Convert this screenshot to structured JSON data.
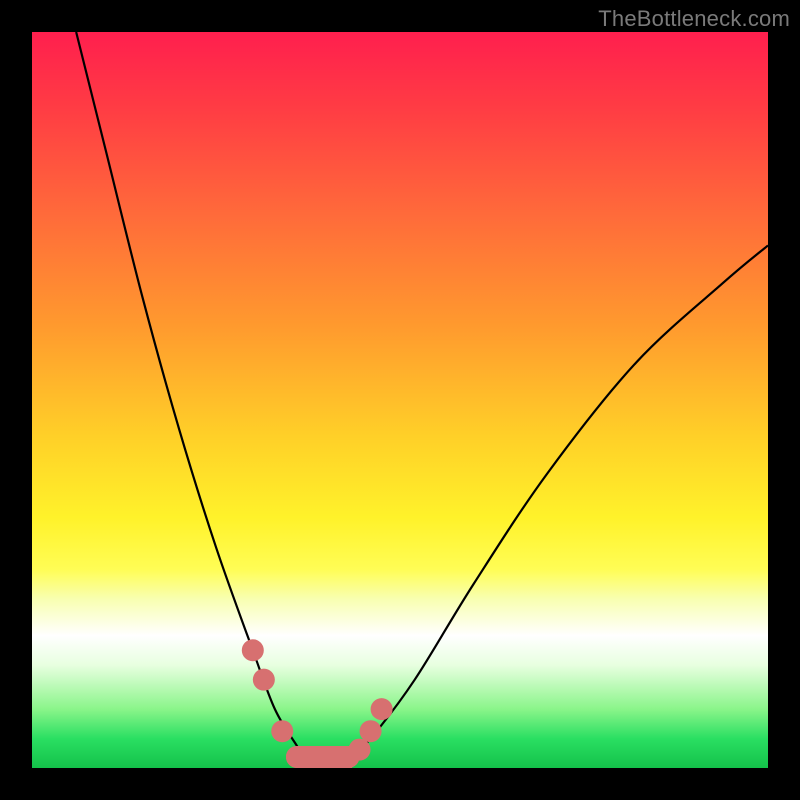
{
  "watermark": "TheBottleneck.com",
  "colors": {
    "frame": "#000000",
    "curve": "#000000",
    "marker": "#d77070",
    "gradient_top": "#ff1f4e",
    "gradient_bottom": "#14c24a"
  },
  "chart_data": {
    "type": "line",
    "title": "",
    "xlabel": "",
    "ylabel": "",
    "xlim": [
      0,
      100
    ],
    "ylim": [
      0,
      100
    ],
    "grid": false,
    "legend": false,
    "annotations": [
      "TheBottleneck.com"
    ],
    "series": [
      {
        "name": "bottleneck-curve-left",
        "x": [
          6,
          10,
          15,
          20,
          25,
          30,
          33,
          36,
          38
        ],
        "y": [
          100,
          84,
          64,
          46,
          30,
          16,
          8,
          3,
          0
        ]
      },
      {
        "name": "bottleneck-curve-right",
        "x": [
          42,
          46,
          52,
          60,
          70,
          82,
          94,
          100
        ],
        "y": [
          0,
          4,
          12,
          25,
          40,
          55,
          66,
          71
        ]
      }
    ],
    "markers": {
      "name": "highlight-dots",
      "points": [
        {
          "x": 30,
          "y": 16
        },
        {
          "x": 31.5,
          "y": 12
        },
        {
          "x": 34,
          "y": 5
        },
        {
          "x": 36,
          "y": 1.5
        },
        {
          "x": 38,
          "y": 0
        },
        {
          "x": 40,
          "y": 0
        },
        {
          "x": 42,
          "y": 0
        },
        {
          "x": 44.5,
          "y": 2.5
        },
        {
          "x": 46,
          "y": 5
        },
        {
          "x": 47.5,
          "y": 8
        }
      ]
    },
    "bottom_link": {
      "x": [
        36,
        43
      ],
      "y": [
        0,
        0
      ]
    }
  }
}
